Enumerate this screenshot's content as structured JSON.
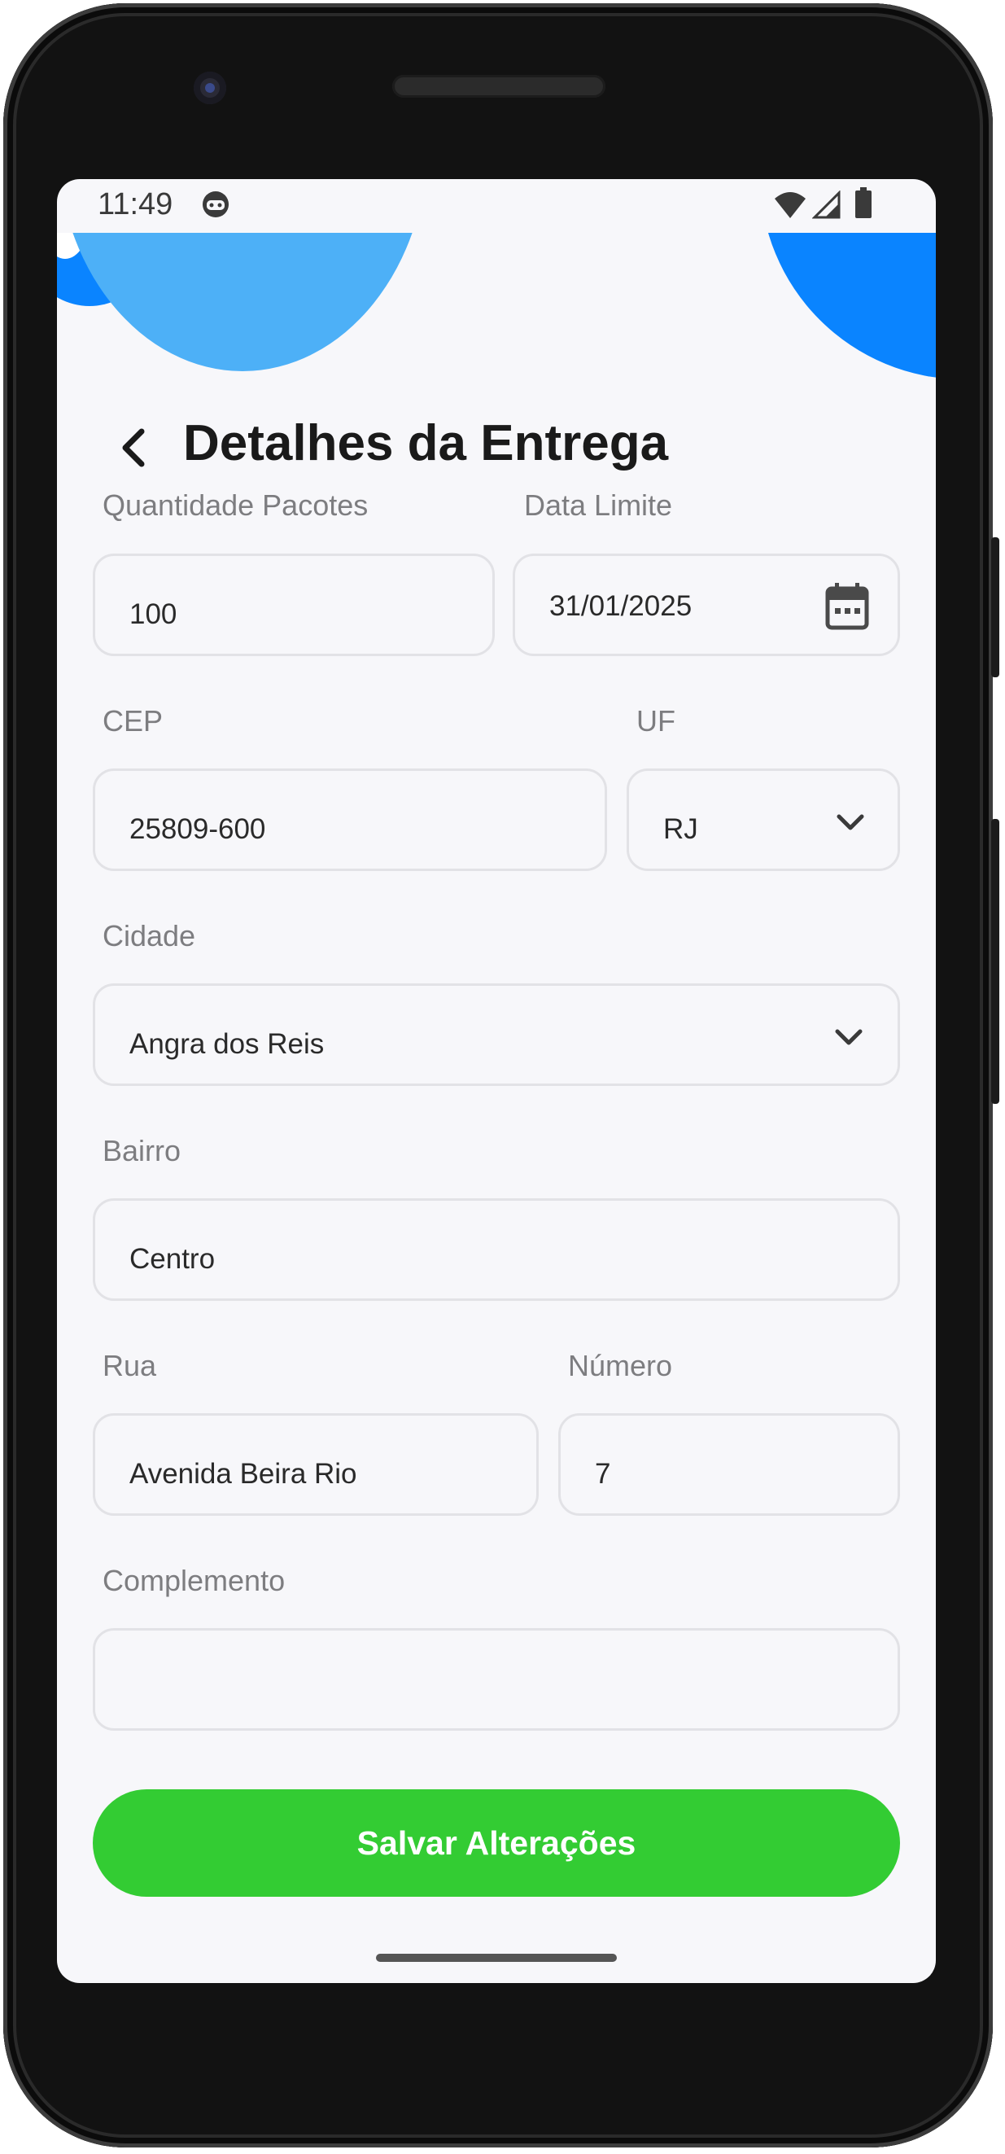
{
  "status_bar": {
    "time": "11:49"
  },
  "header": {
    "title": "Detalhes da Entrega"
  },
  "form": {
    "quantidade": {
      "label": "Quantidade Pacotes",
      "value": "100"
    },
    "data_limite": {
      "label": "Data Limite",
      "value": "31/01/2025"
    },
    "cep": {
      "label": "CEP",
      "value": "25809-600"
    },
    "uf": {
      "label": "UF",
      "value": "RJ"
    },
    "cidade": {
      "label": "Cidade",
      "value": "Angra dos Reis"
    },
    "bairro": {
      "label": "Bairro",
      "value": "Centro"
    },
    "rua": {
      "label": "Rua",
      "value": "Avenida Beira Rio"
    },
    "numero": {
      "label": "Número",
      "value": "7"
    },
    "complemento": {
      "label": "Complemento",
      "value": ""
    }
  },
  "actions": {
    "save_label": "Salvar Alterações"
  },
  "colors": {
    "accent_blue": "#0a84ff",
    "light_blue": "#4db0f7",
    "save_green": "#33cc33",
    "screen_bg": "#f7f7fa"
  },
  "icons": {
    "back": "chevron-left-icon",
    "calendar": "calendar-icon",
    "dropdown": "chevron-down-icon",
    "wifi": "wifi-icon",
    "signal": "signal-icon",
    "battery": "battery-icon",
    "notification": "android-robot-icon"
  }
}
